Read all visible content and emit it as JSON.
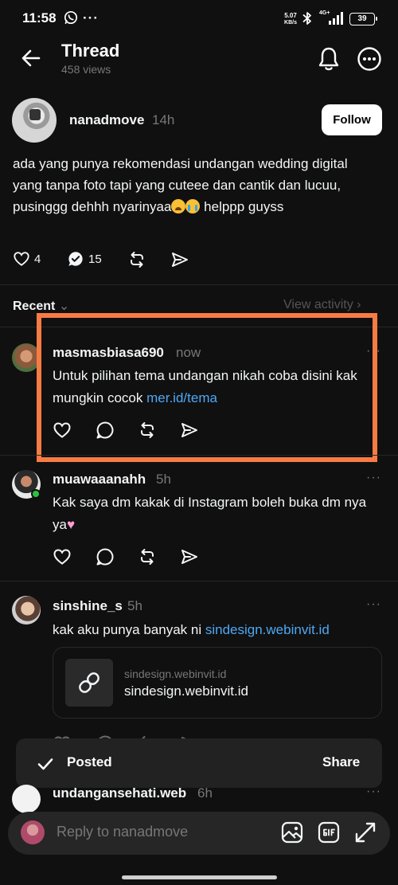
{
  "status_bar": {
    "time": "11:58",
    "net_speed": "5.07",
    "net_unit": "KB/s",
    "network": "4G+",
    "battery": "39",
    "icons": [
      "whatsapp-icon",
      "more-dots-icon",
      "bluetooth-icon",
      "signal-icon",
      "battery-icon"
    ]
  },
  "header": {
    "title": "Thread",
    "views": "458 views",
    "icons": [
      "back-arrow-icon",
      "bell-icon",
      "more-icon"
    ]
  },
  "post": {
    "username": "nanadmove",
    "time": "14h",
    "follow_label": "Follow",
    "text_part1": "ada yang punya rekomendasi undangan wedding digital yang tanpa foto tapi yang cuteee dan cantik dan lucuu, pusinggg dehhh nyarinyaa",
    "text_part2": " helppp guyss",
    "likes": "4",
    "replies": "15"
  },
  "recent_bar": {
    "label": "Recent",
    "view_activity": "View activity"
  },
  "replies": [
    {
      "username": "masmasbiasa690",
      "time": "now",
      "text": "Untuk pilihan tema undangan nikah coba disini kak mungkin cocok ",
      "link": "mer.id/tema"
    },
    {
      "username": "muawaaanahh",
      "time": "5h",
      "text": "Kak saya dm kakak di Instagram boleh buka dm nya ya"
    },
    {
      "username": "sinshine_s",
      "time": "5h",
      "text": "kak aku punya banyak ni ",
      "link": "sindesign.webinvit.id",
      "card": {
        "domain": "sindesign.webinvit.id",
        "title": "sindesign.webinvit.id"
      }
    },
    {
      "username": "undangansehati.web",
      "time": "6h"
    }
  ],
  "toast": {
    "message": "Posted",
    "action": "Share"
  },
  "composer": {
    "placeholder": "Reply to nanadmove",
    "icons": [
      "image-icon",
      "gif-icon",
      "expand-icon"
    ]
  },
  "colors": {
    "background": "#101010",
    "link": "#4ea8f5",
    "highlight": "#f97b44",
    "online": "#2ac340"
  }
}
